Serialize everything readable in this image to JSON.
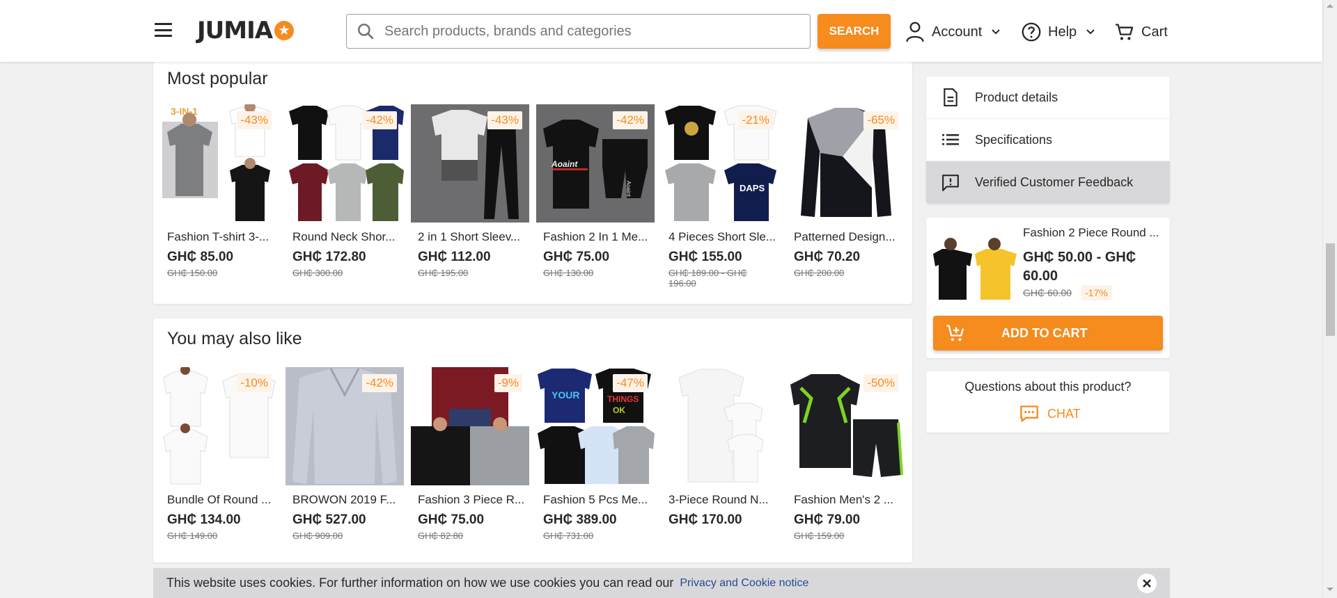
{
  "header": {
    "search_placeholder": "Search products, brands and categories",
    "search_button": "SEARCH",
    "account": "Account",
    "help": "Help",
    "cart": "Cart",
    "logo": "JUMIA"
  },
  "most_popular": {
    "title": "Most popular",
    "items": [
      {
        "name": "Fashion T-shirt 3-...",
        "price": "GH₵ 85.00",
        "old_price": "GH₵ 150.00",
        "discount": "-43%",
        "thumb_label": "3-IN-1"
      },
      {
        "name": "Round Neck Shor...",
        "price": "GH₵ 172.80",
        "old_price": "GH₵ 300.00",
        "discount": "-42%"
      },
      {
        "name": "2 in 1 Short Sleev...",
        "price": "GH₵ 112.00",
        "old_price": "GH₵ 195.00",
        "discount": "-43%"
      },
      {
        "name": "Fashion 2 In 1 Me...",
        "price": "GH₵ 75.00",
        "old_price": "GH₵ 130.00",
        "discount": "-42%"
      },
      {
        "name": "4 Pieces Short Sle...",
        "price": "GH₵ 155.00",
        "old_price": "GH₵ 189.00 - GH₵ 196.00",
        "discount": "-21%"
      },
      {
        "name": "Patterned Design...",
        "price": "GH₵ 70.20",
        "old_price": "GH₵ 200.00",
        "discount": "-65%"
      }
    ]
  },
  "you_may_also_like": {
    "title": "You may also like",
    "items": [
      {
        "name": "Bundle Of Round ...",
        "price": "GH₵ 134.00",
        "old_price": "GH₵ 149.00",
        "discount": "-10%"
      },
      {
        "name": "BROWON 2019 F...",
        "price": "GH₵ 527.00",
        "old_price": "GH₵ 909.00",
        "discount": "-42%"
      },
      {
        "name": "Fashion 3 Piece R...",
        "price": "GH₵ 75.00",
        "old_price": "GH₵ 82.80",
        "discount": "-9%"
      },
      {
        "name": "Fashion 5 Pcs Me...",
        "price": "GH₵ 389.00",
        "old_price": "GH₵ 731.00",
        "discount": "-47%"
      },
      {
        "name": "3-Piece Round N...",
        "price": "GH₵ 170.00",
        "old_price": "",
        "discount": ""
      },
      {
        "name": "Fashion Men's 2 ...",
        "price": "GH₵ 79.00",
        "old_price": "GH₵ 159.00",
        "discount": "-50%"
      }
    ]
  },
  "sidebar": {
    "nav": [
      {
        "label": "Product details",
        "icon": "document-icon"
      },
      {
        "label": "Specifications",
        "icon": "list-icon"
      },
      {
        "label": "Verified Customer Feedback",
        "icon": "feedback-icon"
      }
    ],
    "mini_product": {
      "name": "Fashion 2 Piece Round ...",
      "price": "GH₵ 50.00 - GH₵ 60.00",
      "old_price": "GH₵ 60.00",
      "discount": "-17%"
    },
    "add_to_cart": "ADD TO CART",
    "questions": "Questions about this product?",
    "chat": "CHAT"
  },
  "cookie": {
    "text": "This website uses cookies. For further information on how we use cookies you can read our",
    "link": "Privacy and Cookie notice"
  },
  "colors": {
    "accent": "#f68b1e",
    "text": "#282828",
    "muted": "#75757a",
    "link": "#264996"
  }
}
